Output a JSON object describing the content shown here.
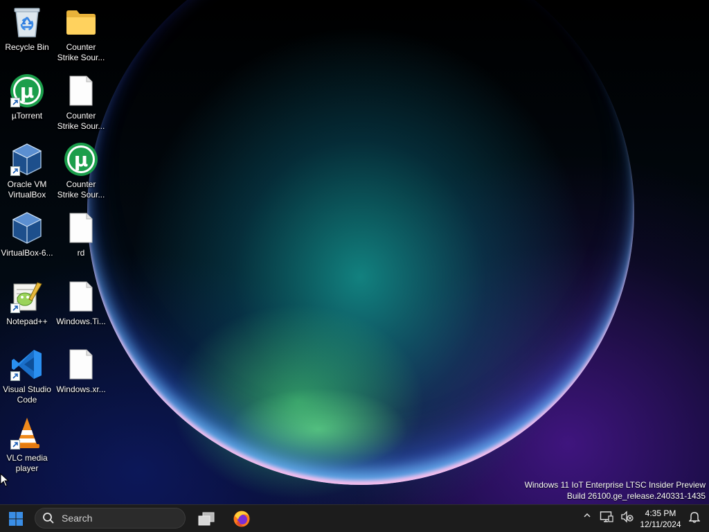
{
  "desktop": {
    "icons": [
      {
        "label": "Recycle Bin",
        "icon": "recycle-bin-icon"
      },
      {
        "label": "Counter\nStrike Sour...",
        "icon": "folder-icon"
      },
      {
        "label": "µTorrent",
        "icon": "utorrent-icon"
      },
      {
        "label": "Counter\nStrike Sour...",
        "icon": "document-icon"
      },
      {
        "label": "Oracle VM\nVirtualBox",
        "icon": "virtualbox-icon"
      },
      {
        "label": "Counter\nStrike Sour...",
        "icon": "utorrent-icon"
      },
      {
        "label": "VirtualBox-6...",
        "icon": "virtualbox-icon"
      },
      {
        "label": "rd",
        "icon": "document-icon"
      },
      {
        "label": "Notepad++",
        "icon": "notepad-plus-plus-icon"
      },
      {
        "label": "Windows.Ti...",
        "icon": "document-icon"
      },
      {
        "label": "Visual Studio\nCode",
        "icon": "vscode-icon"
      },
      {
        "label": "Windows.xr...",
        "icon": "document-icon"
      },
      {
        "label": "VLC media\nplayer",
        "icon": "vlc-icon"
      }
    ],
    "watermark": {
      "line1": "Windows 11 IoT Enterprise LTSC Insider Preview",
      "line2": "Build 26100.ge_release.240331-1435"
    }
  },
  "taskbar": {
    "start_icon": "windows-start-icon",
    "search_placeholder": "Search",
    "apps": [
      {
        "name": "task-view",
        "icon": "task-view-icon"
      },
      {
        "name": "firefox",
        "icon": "firefox-icon"
      }
    ],
    "tray": {
      "time": "4:35 PM",
      "date": "12/11/2024"
    }
  },
  "colors": {
    "taskbar_bg": "#1c1c1c",
    "start_blue": "#3a8ee6",
    "utorrent_green": "#1b9e4b",
    "vscode_blue": "#2a8ff0",
    "vlc_orange": "#f08a1c"
  }
}
